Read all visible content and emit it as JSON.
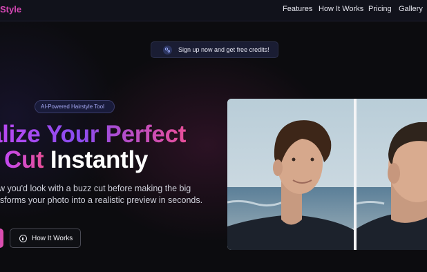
{
  "header": {
    "brand": "Style",
    "nav": [
      {
        "label": "Features"
      },
      {
        "label": "How It Works"
      },
      {
        "label": "Pricing"
      },
      {
        "label": "Gallery"
      }
    ]
  },
  "announcement": {
    "icon": "sparkle-icon",
    "text": "Sign up now and get free credits!"
  },
  "hero": {
    "badge": "AI-Powered Hairstyle Tool",
    "headline_line1": "alize Your Perfect",
    "headline_line2_accent": "Cut",
    "headline_line2_rest": " Instantly",
    "subtitle_line1": "w you'd look with a buzz cut before making the big",
    "subtitle_line2": "ansforms your photo into a realistic preview in seconds.",
    "secondary_cta": "How It Works",
    "secondary_cta_icon": "info-icon"
  },
  "colors": {
    "accent_purple": "#8a4cf0",
    "accent_pink": "#e84f9a",
    "background": "#0c0c0f"
  }
}
